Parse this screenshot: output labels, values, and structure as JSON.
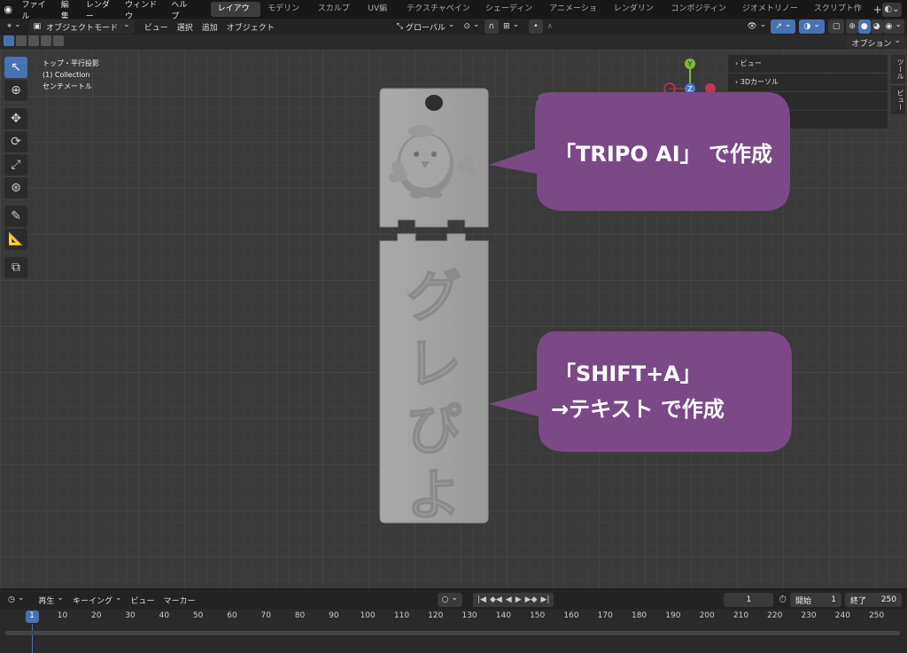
{
  "top_menu": [
    "ファイル",
    "編集",
    "レンダー",
    "ウィンドウ",
    "ヘルプ"
  ],
  "workspace_tabs": [
    {
      "label": "レイアウト",
      "active": true
    },
    {
      "label": "モデリング",
      "active": false
    },
    {
      "label": "スカルプト",
      "active": false
    },
    {
      "label": "UV編集",
      "active": false
    },
    {
      "label": "テクスチャペイント",
      "active": false
    },
    {
      "label": "シェーディング",
      "active": false
    },
    {
      "label": "アニメーション",
      "active": false
    },
    {
      "label": "レンダリング",
      "active": false
    },
    {
      "label": "コンポジティング",
      "active": false
    },
    {
      "label": "ジオメトリノード",
      "active": false
    },
    {
      "label": "スクリプト作成",
      "active": false
    }
  ],
  "add_workspace": "+",
  "header": {
    "mode": "オブジェクトモード",
    "menus": [
      "ビュー",
      "選択",
      "追加",
      "オブジェクト"
    ],
    "transform_orientation": "グローバル",
    "options": "オプション"
  },
  "viewport_info": {
    "line1": "トップ・平行投影",
    "line2": "(1) Collection",
    "line3": "センチメートル"
  },
  "gizmo": {
    "y": "Y",
    "z": "Z"
  },
  "npanel": {
    "items": [
      "ビュー",
      "3Dカーソル",
      "ン",
      "ン"
    ]
  },
  "side_tabs": [
    "ツール",
    "ビュー"
  ],
  "callouts": [
    {
      "text": "「TRIPO AI」 で作成"
    },
    {
      "line1": "「SHIFT+A」",
      "line2": "→テキスト で作成"
    }
  ],
  "keychain_text": [
    "グ",
    "レ",
    "ぴ",
    "よ"
  ],
  "timeline": {
    "menus": [
      "再生",
      "キーイング",
      "ビュー",
      "マーカー"
    ],
    "current_frame": "1",
    "start_label": "開始",
    "start": "1",
    "end_label": "終了",
    "end": "250",
    "ticks": [
      "1",
      "10",
      "20",
      "30",
      "40",
      "50",
      "60",
      "70",
      "80",
      "90",
      "100",
      "110",
      "120",
      "130",
      "140",
      "150",
      "160",
      "170",
      "180",
      "190",
      "200",
      "210",
      "220",
      "230",
      "240",
      "250"
    ]
  },
  "colors": {
    "accent": "#4772b3",
    "callout": "#7b4986",
    "axis_x": "#c8344b",
    "axis_y": "#7cb83a",
    "axis_z": "#3b7de0"
  }
}
